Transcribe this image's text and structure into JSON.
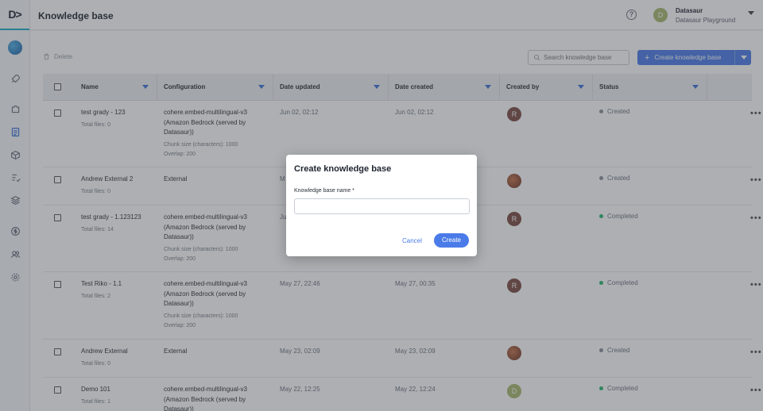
{
  "app": {
    "logo": "D>",
    "page_title": "Knowledge base"
  },
  "account": {
    "avatar_letter": "D",
    "name": "Datasaur",
    "team": "Datasaur Playground"
  },
  "toolbar": {
    "delete_label": "Delete",
    "search_placeholder": "Search knowledge base",
    "create_label": "Create knowledge base"
  },
  "table": {
    "columns": [
      "Name",
      "Configuration",
      "Date updated",
      "Date created",
      "Created by",
      "Status"
    ],
    "rows": [
      {
        "name": "test grady - 123",
        "files": "Total files: 0",
        "config": [
          "cohere.embed-multilingual-v3",
          "(Amazon Bedrock (served by",
          "Datasaur))"
        ],
        "chunk": "Chunk size (characters): 1000",
        "overlap": "Overlap: 200",
        "updated": "Jun 02, 02:12",
        "created": "Jun 02, 02:12",
        "avatar": "R",
        "status": "Created"
      },
      {
        "name": "Andrew External 2",
        "files": "Total files: 0",
        "config": [
          "External"
        ],
        "chunk": "",
        "overlap": "",
        "updated": "M",
        "created": "",
        "avatar": "",
        "status": "Created"
      },
      {
        "name": "test grady - 1.123123",
        "files": "Total files: 14",
        "config": [
          "cohere.embed-multilingual-v3",
          "(Amazon Bedrock (served by",
          "Datasaur))"
        ],
        "chunk": "Chunk size (characters): 1000",
        "overlap": "Overlap: 200",
        "updated": "Ju",
        "created": "",
        "avatar": "R",
        "status": "Completed"
      },
      {
        "name": "Test Riko - 1.1",
        "files": "Total files: 2",
        "config": [
          "cohere.embed-multilingual-v3",
          "(Amazon Bedrock (served by",
          "Datasaur))"
        ],
        "chunk": "Chunk size (characters): 1000",
        "overlap": "Overlap: 200",
        "updated": "May 27, 22:46",
        "created": "May 27, 00:35",
        "avatar": "R",
        "status": "Completed"
      },
      {
        "name": "Andrew External",
        "files": "Total files: 0",
        "config": [
          "External"
        ],
        "chunk": "",
        "overlap": "",
        "updated": "May 23, 02:09",
        "created": "May 23, 02:09",
        "avatar": "",
        "status": "Created"
      },
      {
        "name": "Demo 101",
        "files": "Total files: 1",
        "config": [
          "cohere.embed-multilingual-v3",
          "(Amazon Bedrock (served by",
          "Datasaur))"
        ],
        "chunk": "",
        "overlap": "",
        "updated": "May 22, 12:25",
        "created": "May 22, 12:24",
        "avatar": "D",
        "status": "Completed"
      }
    ],
    "more_label": "•••"
  },
  "modal": {
    "title": "Create knowledge base",
    "field_label": "Knowledge base name *",
    "field_value": "",
    "cancel_label": "Cancel",
    "create_label": "Create"
  },
  "colors": {
    "accent": "#4a7be8",
    "completed": "#2bb673",
    "created": "#8a9099"
  }
}
